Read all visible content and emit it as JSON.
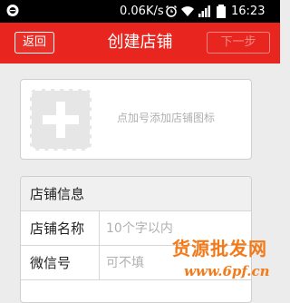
{
  "status_bar": {
    "net_speed": "0.06K/s",
    "time": "16:23",
    "icons": [
      "message-icon",
      "alarm-icon",
      "wifi-icon",
      "signal-icon",
      "battery-icon"
    ]
  },
  "header": {
    "back_label": "返回",
    "title": "创建店铺",
    "next_label": "下一步",
    "background_color": "#e8261f"
  },
  "logo": {
    "icon": "plus-icon",
    "hint": "点加号添加店铺图标"
  },
  "shop_info": {
    "section_title": "店铺信息",
    "rows": [
      {
        "label": "店铺名称",
        "placeholder": "10个字以内"
      },
      {
        "label": "微信号",
        "placeholder": "可不填"
      }
    ]
  },
  "watermark": {
    "text_cn": "货源批发网",
    "url": "www.6pf.cn"
  }
}
